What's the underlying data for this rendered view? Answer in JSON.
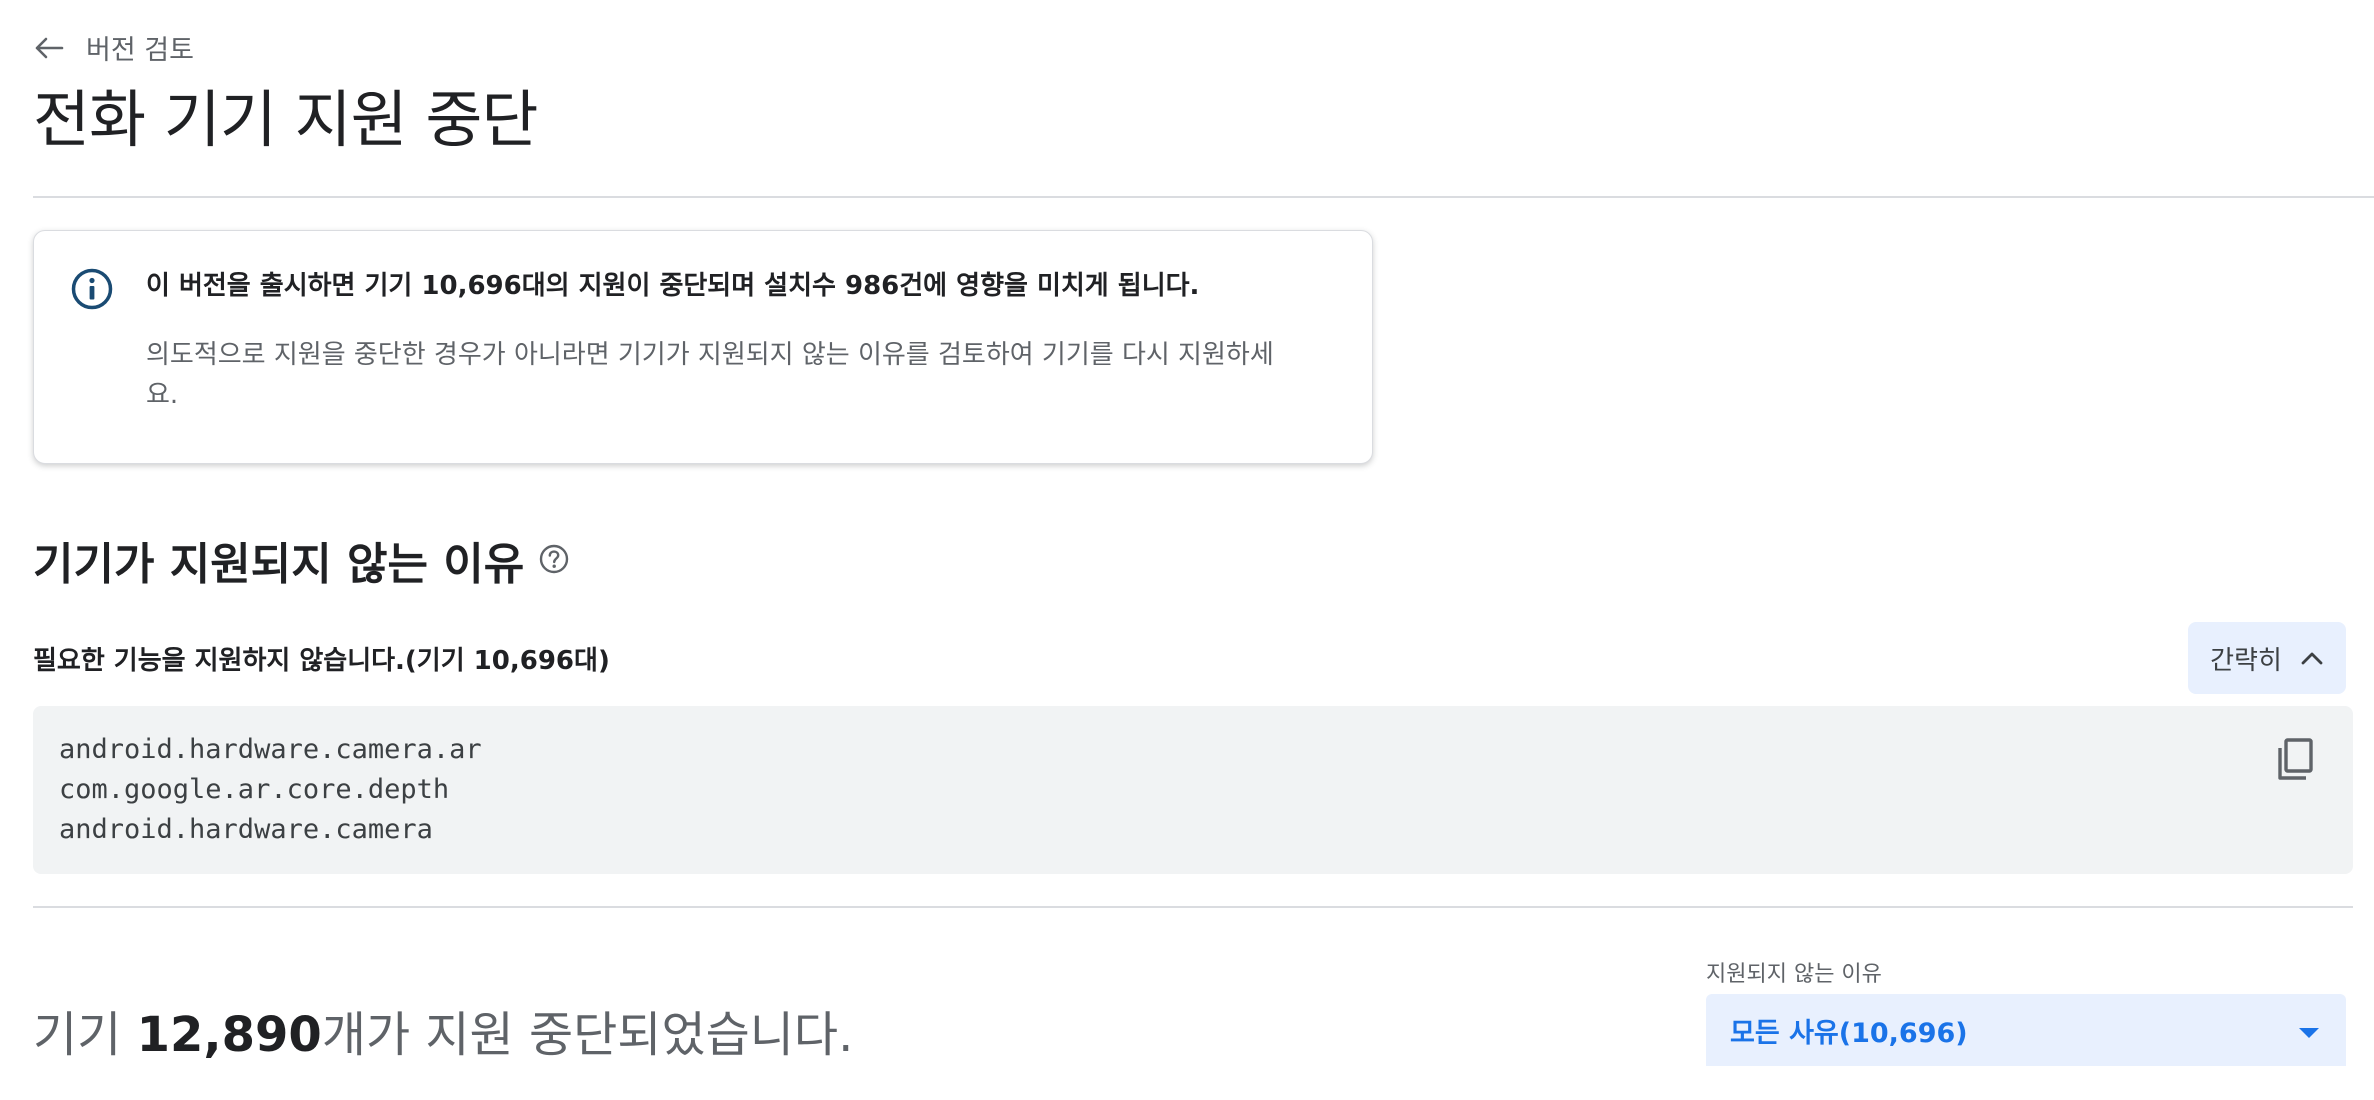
{
  "nav": {
    "back_label": "버전 검토",
    "back_icon": "arrow-left-icon"
  },
  "page": {
    "title": "전화 기기 지원 중단"
  },
  "notice": {
    "icon": "info-icon",
    "headline": "이 버전을 출시하면 기기 10,696대의 지원이 중단되며 설치수 986건에 영향을 미치게 됩니다.",
    "body": "의도적으로 지원을 중단한 경우가 아니라면 기기가 지원되지 않는 이유를 검토하여 기기를 다시 지원하세요."
  },
  "reasons_section": {
    "title": "기기가 지원되지 않는 이유",
    "help_icon": "help-circle-icon",
    "reason_label": "필요한 기능을 지원하지 않습니다.(기기 10,696대)",
    "collapse_label": "간략히",
    "collapse_icon": "chevron-up-icon",
    "features": [
      "android.hardware.camera.ar",
      "com.google.ar.core.depth",
      "android.hardware.camera"
    ],
    "copy_icon": "copy-icon"
  },
  "summary": {
    "prefix": "기기 ",
    "count": "12,890",
    "suffix": "개가 지원 중단되었습니다."
  },
  "filter": {
    "label": "지원되지 않는 이유",
    "selected": "모든 사유(10,696)",
    "dropdown_icon": "dropdown-arrow-icon"
  },
  "colors": {
    "accent_blue": "#1a73e8",
    "button_bg": "#e8f0fe",
    "code_bg": "#f1f3f4",
    "info_icon": "#1a4b73"
  }
}
